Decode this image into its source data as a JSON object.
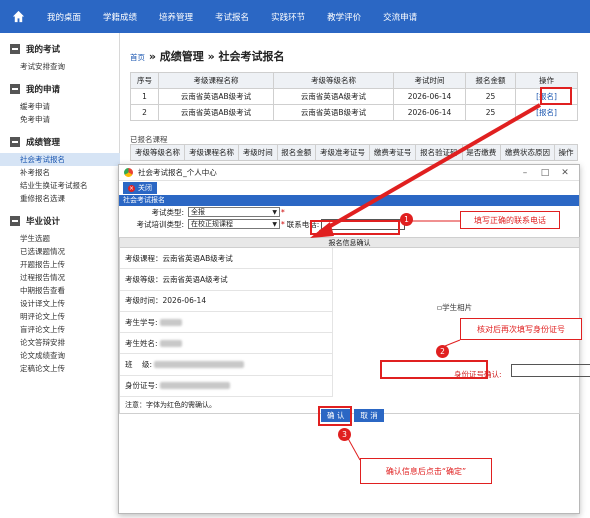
{
  "topnav": {
    "items": [
      "我的桌面",
      "学籍成绩",
      "培养管理",
      "考试报名",
      "实践环节",
      "教学评价",
      "交流申请"
    ]
  },
  "sidebar": {
    "groups": [
      {
        "title": "我的考试",
        "items": [
          "考试安排查询"
        ]
      },
      {
        "title": "我的申请",
        "items": [
          "缓考申请",
          "免考申请"
        ]
      },
      {
        "title": "成绩管理",
        "items": [
          "社会考试报名",
          "补考报名",
          "结业生换证考试报名",
          "重修报名选课"
        ]
      },
      {
        "title": "毕业设计",
        "items": [
          "学生选题",
          "已选课题情况",
          "开题报告上传",
          "过程报告情况",
          "中期报告查看",
          "设计译文上传",
          "明评论文上传",
          "盲评论文上传",
          "论文答辩安排",
          "论文成绩查询",
          "定稿论文上传"
        ]
      }
    ]
  },
  "breadcrumb": {
    "home": "首页",
    "sep1": " » ",
    "mid": "成绩管理",
    "sep2": " » ",
    "current": "社会考试报名"
  },
  "exam_table": {
    "headers": [
      "序号",
      "考级课程名称",
      "考级等级名称",
      "考试时间",
      "报名金额",
      "操作"
    ],
    "rows": [
      [
        "1",
        "云南省英语AB级考试",
        "云南省英语A级考试",
        "2026-06-14",
        "25",
        "[报名]"
      ],
      [
        "2",
        "云南省英语AB级考试",
        "云南省英语B级考试",
        "2026-06-14",
        "25",
        "[报名]"
      ]
    ]
  },
  "registered": {
    "caption": "已报名课程",
    "headers": [
      "考级等级名称",
      "考级课程名称",
      "考级时间",
      "报名金额",
      "考级准考证号",
      "缴费考证号",
      "报名验证码",
      "是否缴费",
      "缴费状态原因",
      "操作"
    ]
  },
  "modal": {
    "title": "社会考试报名_个人中心",
    "close_label": "关闭",
    "section": "社会考试报名",
    "exam_type_label": "考试类型:",
    "exam_type_value": "全报",
    "training_type_label": "考试培训类型:",
    "training_type_value": "在校正规课程",
    "phone_label": "联系电话:",
    "info_head": "报名信息确认",
    "info": {
      "course": "考级课程：云南省英语AB级考试",
      "level": "考级等级：云南省英语A级考试",
      "time": "考级时间：2026-06-14",
      "student_no": "考生学号:",
      "name": "考生姓名:",
      "class": "班    级:",
      "idcard": "身份证号:"
    },
    "photo_alt": "学生相片",
    "idcard_confirm_label": "身份证号确认:",
    "note": "注意：字体为红色的需确认。",
    "confirm_label": "确 认",
    "cancel_label": "取 消"
  },
  "annotations": {
    "step1": "1",
    "step2": "2",
    "step3": "3",
    "callout1": "填写正确的联系电话",
    "callout2": "核对后再次填写身份证号",
    "callout3": "确认信息后点击“确定”"
  },
  "colors": {
    "nav": "#2b67c4",
    "annot": "#e02020"
  }
}
